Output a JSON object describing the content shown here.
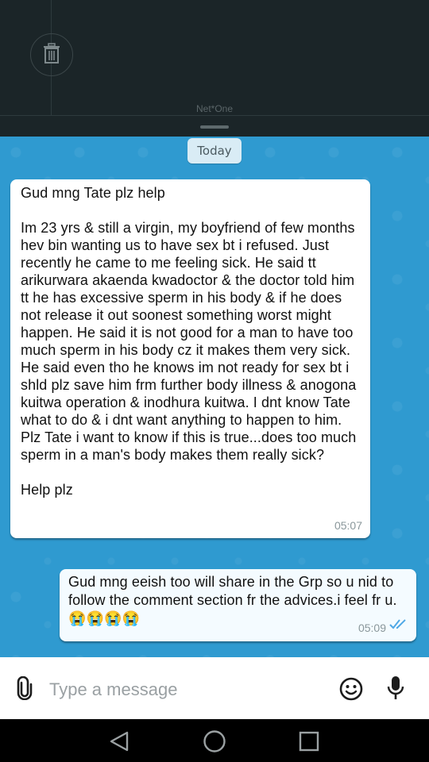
{
  "status_shade": {
    "carrier": "Net*One",
    "delete_icon": "trash-icon"
  },
  "chat": {
    "date_divider": "Today",
    "incoming": {
      "paragraphs": [
        "Gud  mng Tate plz help",
        " Im 23 yrs & still a virgin, my boyfriend of few months hev bin wanting us to have sex bt i refused. Just recently he came to me feeling sick. He said tt arikurwara akaenda kwadoctor & the doctor told him tt he has excessive sperm in his body & if he does not release it out soonest something worst might happen. He said it is not good for a man to have too much sperm in his body cz it makes them very sick. He said even tho he knows im not ready for sex bt i shld plz save him frm further body illness & anogona kuitwa operation & inodhura kuitwa. I dnt know Tate what to do & i dnt want anything to happen to him. Plz Tate i want to know if this is true...does too much sperm in a man's body makes them really sick?",
        "Help plz"
      ],
      "time": "05:07"
    },
    "outgoing": {
      "text": "Gud mng eeish too will share in the Grp so u nid to follow the comment section fr the advices.i feel fr u.😭😭😭😭",
      "time": "05:09",
      "status_icon": "double-check-icon",
      "status_color": "#4fa8e6"
    }
  },
  "input_bar": {
    "placeholder": "Type a message",
    "attach_icon": "paperclip-icon",
    "emoji_icon": "smiley-icon",
    "mic_icon": "microphone-icon"
  },
  "nav_bar": {
    "back_icon": "back-triangle-icon",
    "home_icon": "home-circle-icon",
    "recents_icon": "recents-square-icon"
  },
  "colors": {
    "chat_background": "#2f9ad0",
    "shade_background": "#1b2528"
  }
}
